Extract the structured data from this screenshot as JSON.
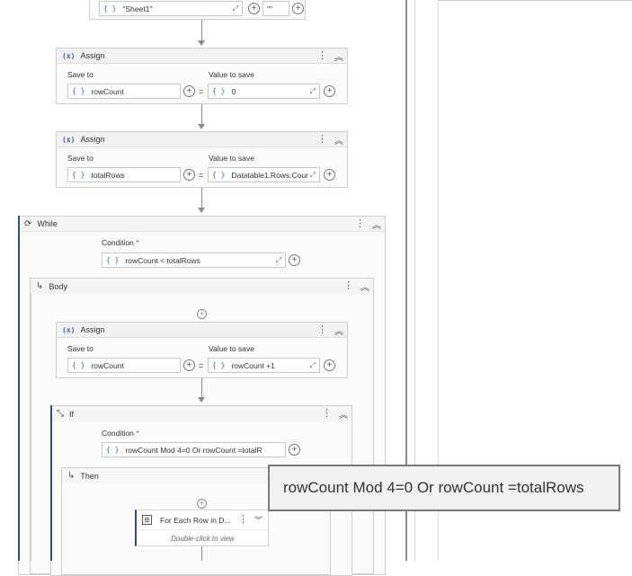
{
  "top_row": {
    "sheet_value": "\"Sheet1\"",
    "range_value": "\"\""
  },
  "assign1": {
    "title": "Assign",
    "save_to_label": "Save to",
    "value_label": "Value to save",
    "save_to": "rowCount",
    "value": "0",
    "equals": "="
  },
  "assign2": {
    "title": "Assign",
    "save_to_label": "Save to",
    "value_label": "Value to save",
    "save_to": "totalRows",
    "value": "Datatable1.Rows.Cour",
    "equals": "="
  },
  "while": {
    "title": "While",
    "condition_label": "Condition",
    "required_mark": "*",
    "condition": "rowCount < totalRows",
    "body_title": "Body"
  },
  "assign3": {
    "title": "Assign",
    "save_to_label": "Save to",
    "value_label": "Value to save",
    "save_to": "rowCount",
    "value": "rowCount +1",
    "equals": "="
  },
  "if": {
    "title": "If",
    "condition_label": "Condition",
    "required_mark": "*",
    "condition": "rowCount Mod 4=0 Or rowCount =totalR",
    "then_title": "Then"
  },
  "tooltip": {
    "text": "rowCount Mod 4=0 Or rowCount =totalRows"
  },
  "foreach": {
    "title": "For Each Row in D...",
    "subtitle": "Double-click to view"
  },
  "icons": {
    "curly": "{ }",
    "assign_glyph": "(x)",
    "plus": "+",
    "expand": "⤢",
    "kebab": "⋮",
    "collapse": "︽",
    "chevron_down": "︾",
    "body_arrow": "↳"
  },
  "colors": {
    "accent_blue": "#2c4f8a",
    "field_border": "#c8c8c8",
    "card_bg": "#fafafa"
  }
}
